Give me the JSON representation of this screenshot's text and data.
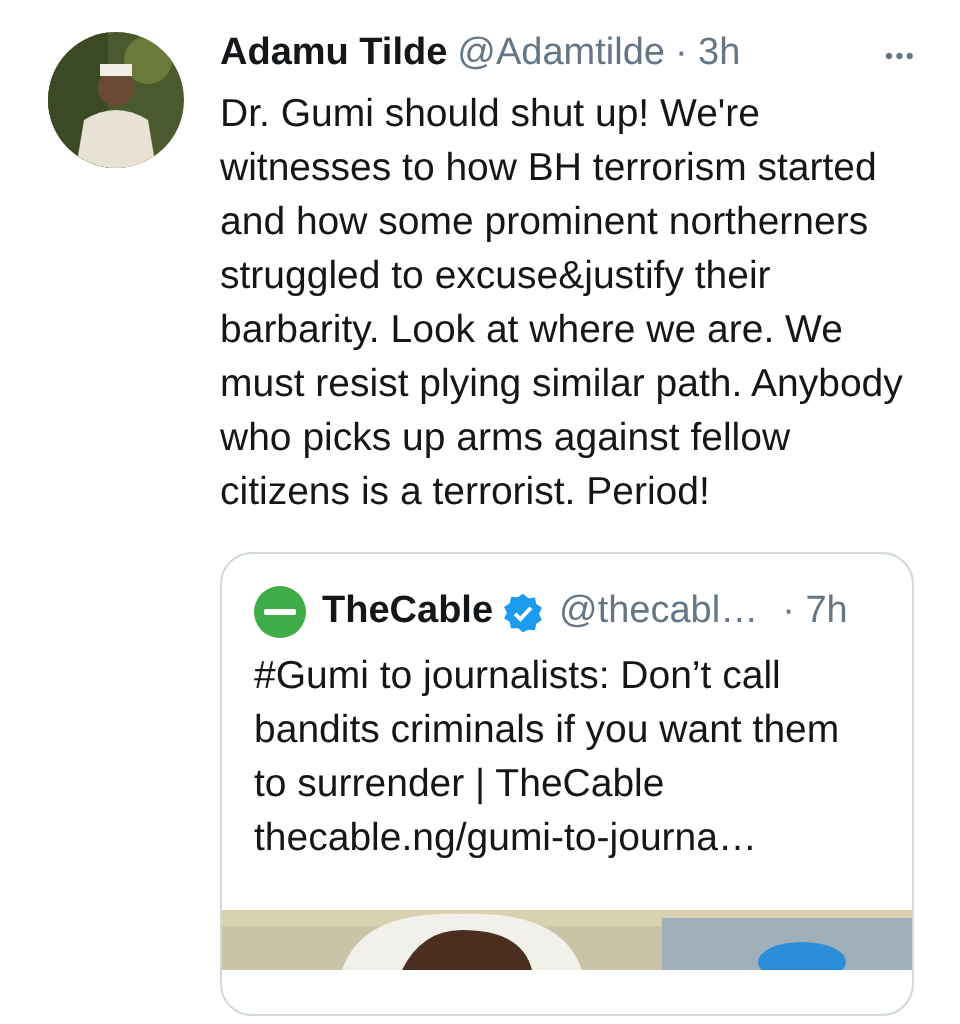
{
  "tweet": {
    "name": "Adamu Tilde",
    "handle": "@Adamtilde",
    "time": "· 3h",
    "more": "•••",
    "text": "Dr. Gumi should shut up! We're witnesses to how BH terrorism started and how some prominent northerners struggled to excuse&justify their barbarity. Look at where we are. We must resist plying similar path. Anybody who picks up arms against fellow citizens is a terrorist. Period!",
    "quote": {
      "name": "TheCable",
      "verified": true,
      "handle": "@thecabl…",
      "time": "· 7h",
      "text": "#Gumi to journalists: Don’t call bandits criminals if you want them to surrender | TheCable",
      "link": "thecable.ng/gumi-to-journa…"
    }
  }
}
